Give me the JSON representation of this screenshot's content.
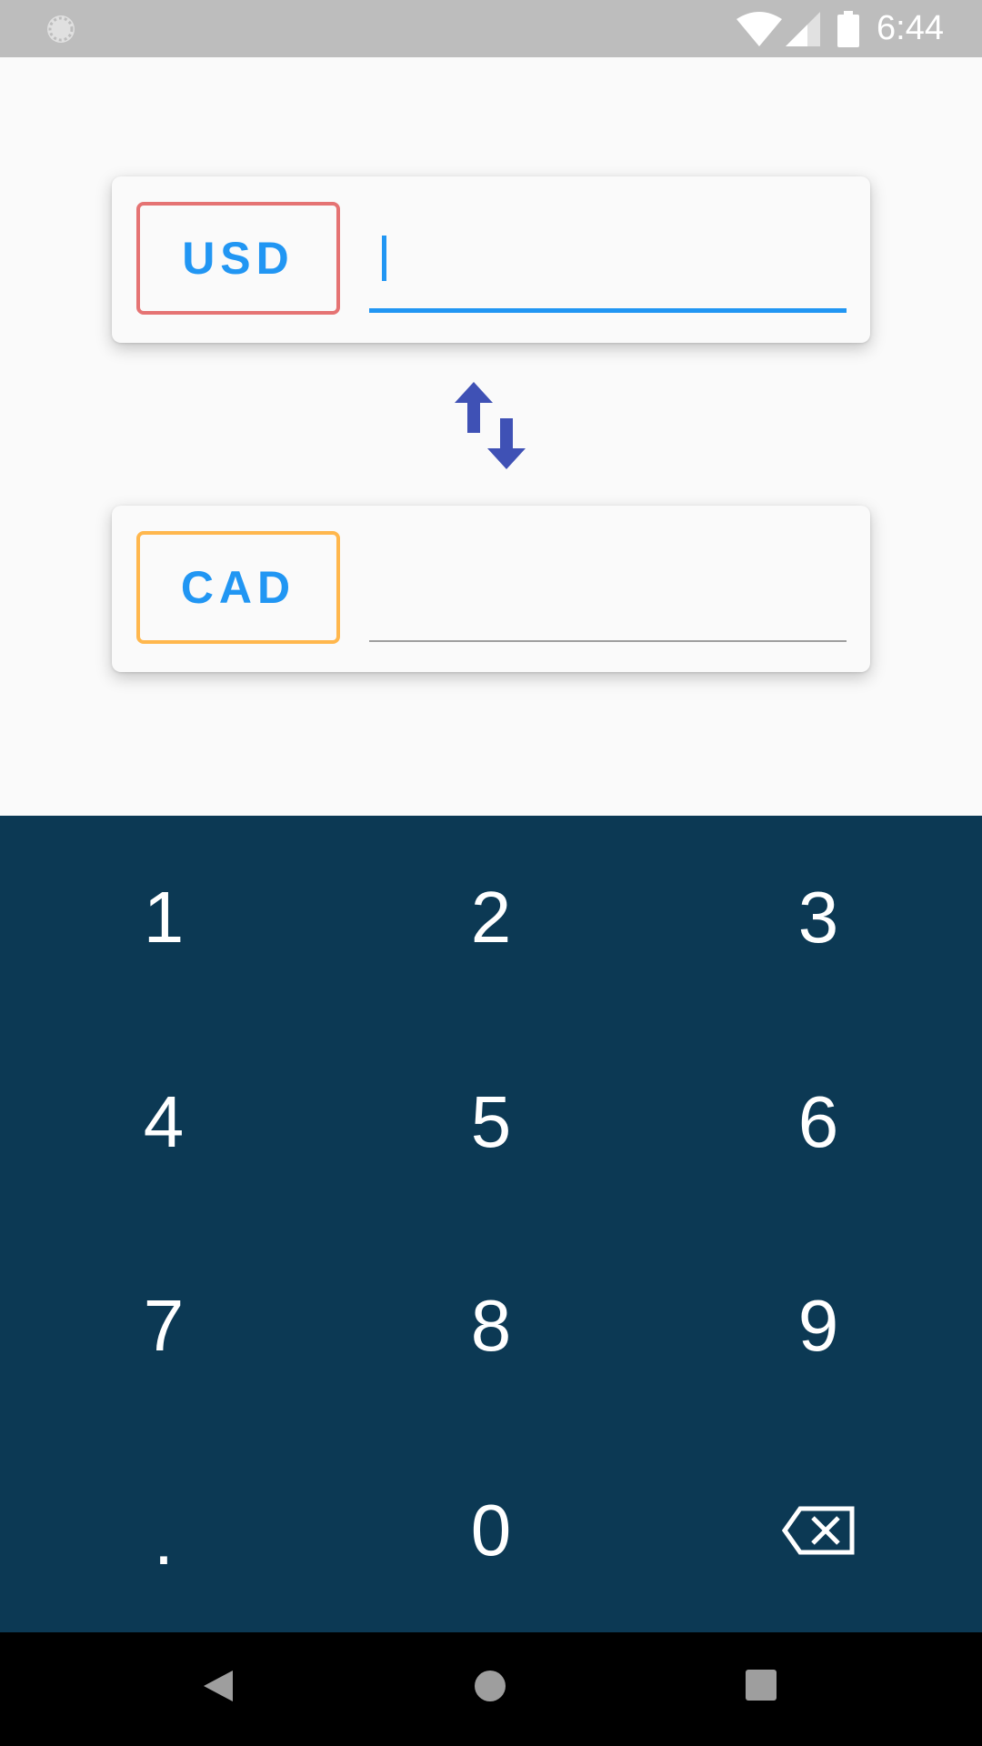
{
  "status_bar": {
    "time": "6:44",
    "icons": [
      "loading-icon",
      "wifi-icon",
      "cell-signal-icon",
      "battery-icon"
    ]
  },
  "converter": {
    "from": {
      "currency": "USD",
      "amount": "",
      "accent_color": "#E57373",
      "focused": true
    },
    "swap_icon": "swap-vertical-icon",
    "to": {
      "currency": "CAD",
      "amount": "",
      "accent_color": "#FFB74D",
      "focused": false
    },
    "text_color": "#2196F3"
  },
  "keypad": {
    "background": "#0C3954",
    "keys": [
      "1",
      "2",
      "3",
      "4",
      "5",
      "6",
      "7",
      "8",
      "9",
      ".",
      "0"
    ],
    "backspace_icon": "backspace-icon"
  },
  "nav_bar": {
    "icons": [
      "back-icon",
      "home-icon",
      "recents-icon"
    ]
  }
}
